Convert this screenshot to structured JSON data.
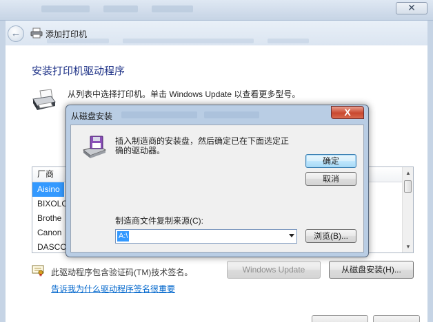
{
  "nav": {
    "title": "添加打印机"
  },
  "wizard": {
    "heading": "安装打印机驱动程序",
    "intro": "从列表中选择打印机。单击 Windows Update 以查看更多型号。",
    "list_header": "厂商",
    "manufacturers": [
      "Aisino",
      "BIXOLO",
      "Brothe",
      "Canon",
      "DASCO"
    ],
    "cert_text": "此驱动程序包含验证码(TM)技术签名。",
    "link_text": "告诉我为什么驱动程序签名很重要",
    "windows_update_label": "Windows Update",
    "have_disk_label": "从磁盘安装(H)..."
  },
  "dialog": {
    "title": "从磁盘安装",
    "close_glyph": "X",
    "message": "插入制造商的安装盘，然后确定已在下面选定正确的驱动器。",
    "ok_label": "确定",
    "cancel_label": "取消",
    "copy_from_label": "制造商文件复制来源(C):",
    "path_value": "A:\\",
    "browse_label": "浏览(B)..."
  },
  "colors": {
    "heading": "#1e3287",
    "link": "#0066cc",
    "selection": "#3399ff"
  }
}
